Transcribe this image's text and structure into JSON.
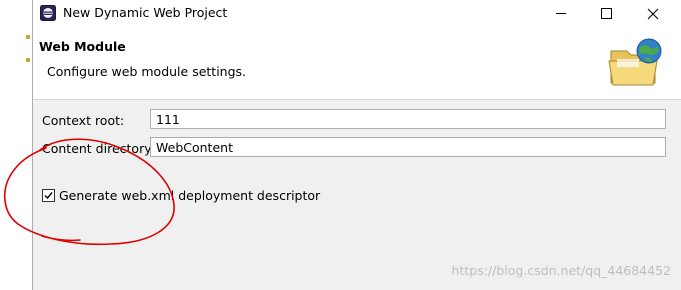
{
  "window": {
    "title": "New Dynamic Web Project",
    "icons": {
      "app": "eclipse-icon",
      "banner": "folder-globe-icon"
    }
  },
  "header": {
    "title": "Web Module",
    "subtitle": "Configure web module settings."
  },
  "form": {
    "context_root_label": "Context root:",
    "context_root_value": "111",
    "content_dir_label": "Content directory:",
    "content_dir_value": "WebContent",
    "generate_label": "Generate web.xml deployment descriptor",
    "generate_checked": true
  },
  "watermark": "https://blog.csdn.net/qq_44684452",
  "colors": {
    "annotation": "#e00000",
    "border": "#abadb3"
  }
}
